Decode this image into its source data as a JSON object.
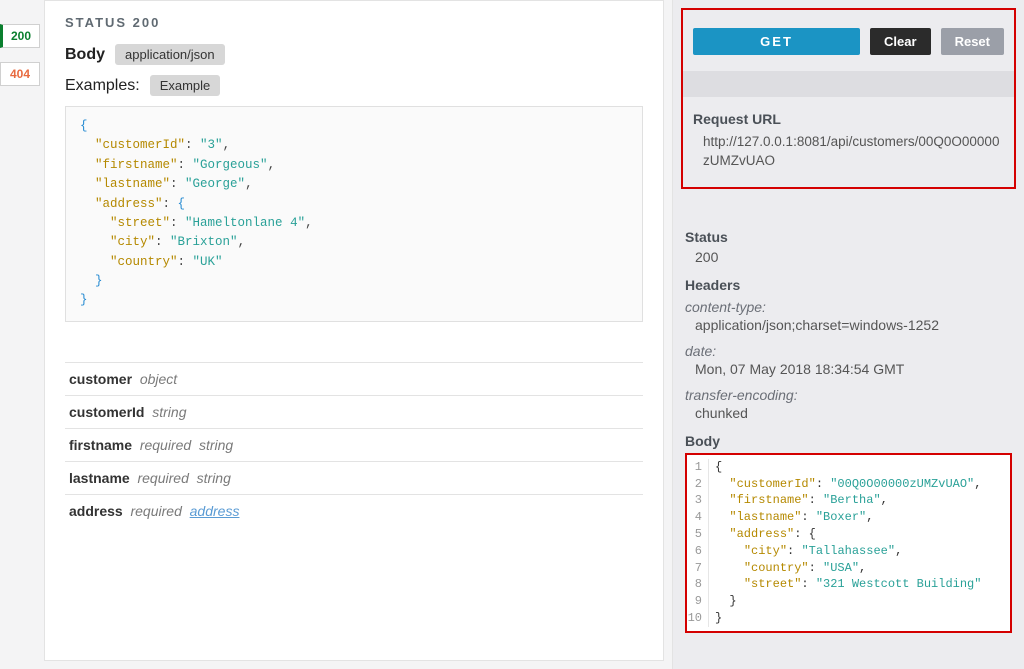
{
  "tabs": {
    "t200": "200",
    "t404": "404"
  },
  "main": {
    "status_title": "STATUS 200",
    "body_label": "Body",
    "content_type": "application/json",
    "examples_label": "Examples:",
    "example_pill": "Example",
    "example_json": {
      "customerId": "3",
      "firstname": "Gorgeous",
      "lastname": "George",
      "address": {
        "street": "Hameltonlane 4",
        "city": "Brixton",
        "country": "UK"
      }
    },
    "fields": [
      {
        "name": "customer",
        "required": "",
        "type": "object"
      },
      {
        "name": "customerId",
        "required": "",
        "type": "string"
      },
      {
        "name": "firstname",
        "required": "required",
        "type": "string"
      },
      {
        "name": "lastname",
        "required": "required",
        "type": "string"
      },
      {
        "name": "address",
        "required": "required",
        "type": "address",
        "link": true
      }
    ]
  },
  "side": {
    "btn_get": "GET",
    "btn_clear": "Clear",
    "btn_reset": "Reset",
    "request_url_label": "Request URL",
    "request_url": "http://127.0.0.1:8081/api/customers/00Q0O00000zUMZvUAO",
    "status_label": "Status",
    "status_value": "200",
    "headers_label": "Headers",
    "headers": [
      {
        "k": "content-type:",
        "v": "application/json;charset=windows-1252"
      },
      {
        "k": "date:",
        "v": "Mon, 07 May 2018 18:34:54 GMT"
      },
      {
        "k": "transfer-encoding:",
        "v": "chunked"
      }
    ],
    "body_label": "Body",
    "body_json": {
      "customerId": "00Q0O00000zUMZvUAO",
      "firstname": "Bertha",
      "lastname": "Boxer",
      "address": {
        "city": "Tallahassee",
        "country": "USA",
        "street": "321 Westcott Building"
      }
    }
  }
}
